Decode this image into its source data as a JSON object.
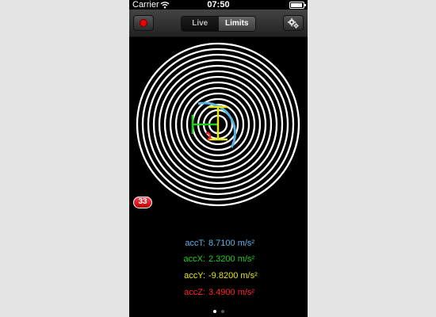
{
  "statusbar": {
    "carrier": "Carrier",
    "time": "07:50",
    "battery_level": 0.9,
    "wifi_icon": "wifi-icon",
    "battery_icon": "battery-icon"
  },
  "toolbar": {
    "record_icon": "record-icon",
    "tabs": [
      {
        "label": "Live",
        "selected": false
      },
      {
        "label": "Limits",
        "selected": true
      }
    ],
    "settings_icon": "gear-icon"
  },
  "target": {
    "ring_count": 14,
    "ring_color": "#ffffff"
  },
  "badge": {
    "count": "33"
  },
  "readouts": [
    {
      "label": "accT:",
      "value": "8.7100 m/s²",
      "color": "#5ab4e6"
    },
    {
      "label": "accX:",
      "value": "2.3200 m/s²",
      "color": "#22cc22"
    },
    {
      "label": "accY:",
      "value": "-9.8200 m/s²",
      "color": "#e6e61a"
    },
    {
      "label": "accZ:",
      "value": "3.4900 m/s²",
      "color": "#ff2222"
    }
  ],
  "page_indicator": {
    "count": 2,
    "current": 0
  },
  "colors": {
    "toolbar": "#333333",
    "background": "#000000",
    "page_bg": "#e5e5e5"
  }
}
